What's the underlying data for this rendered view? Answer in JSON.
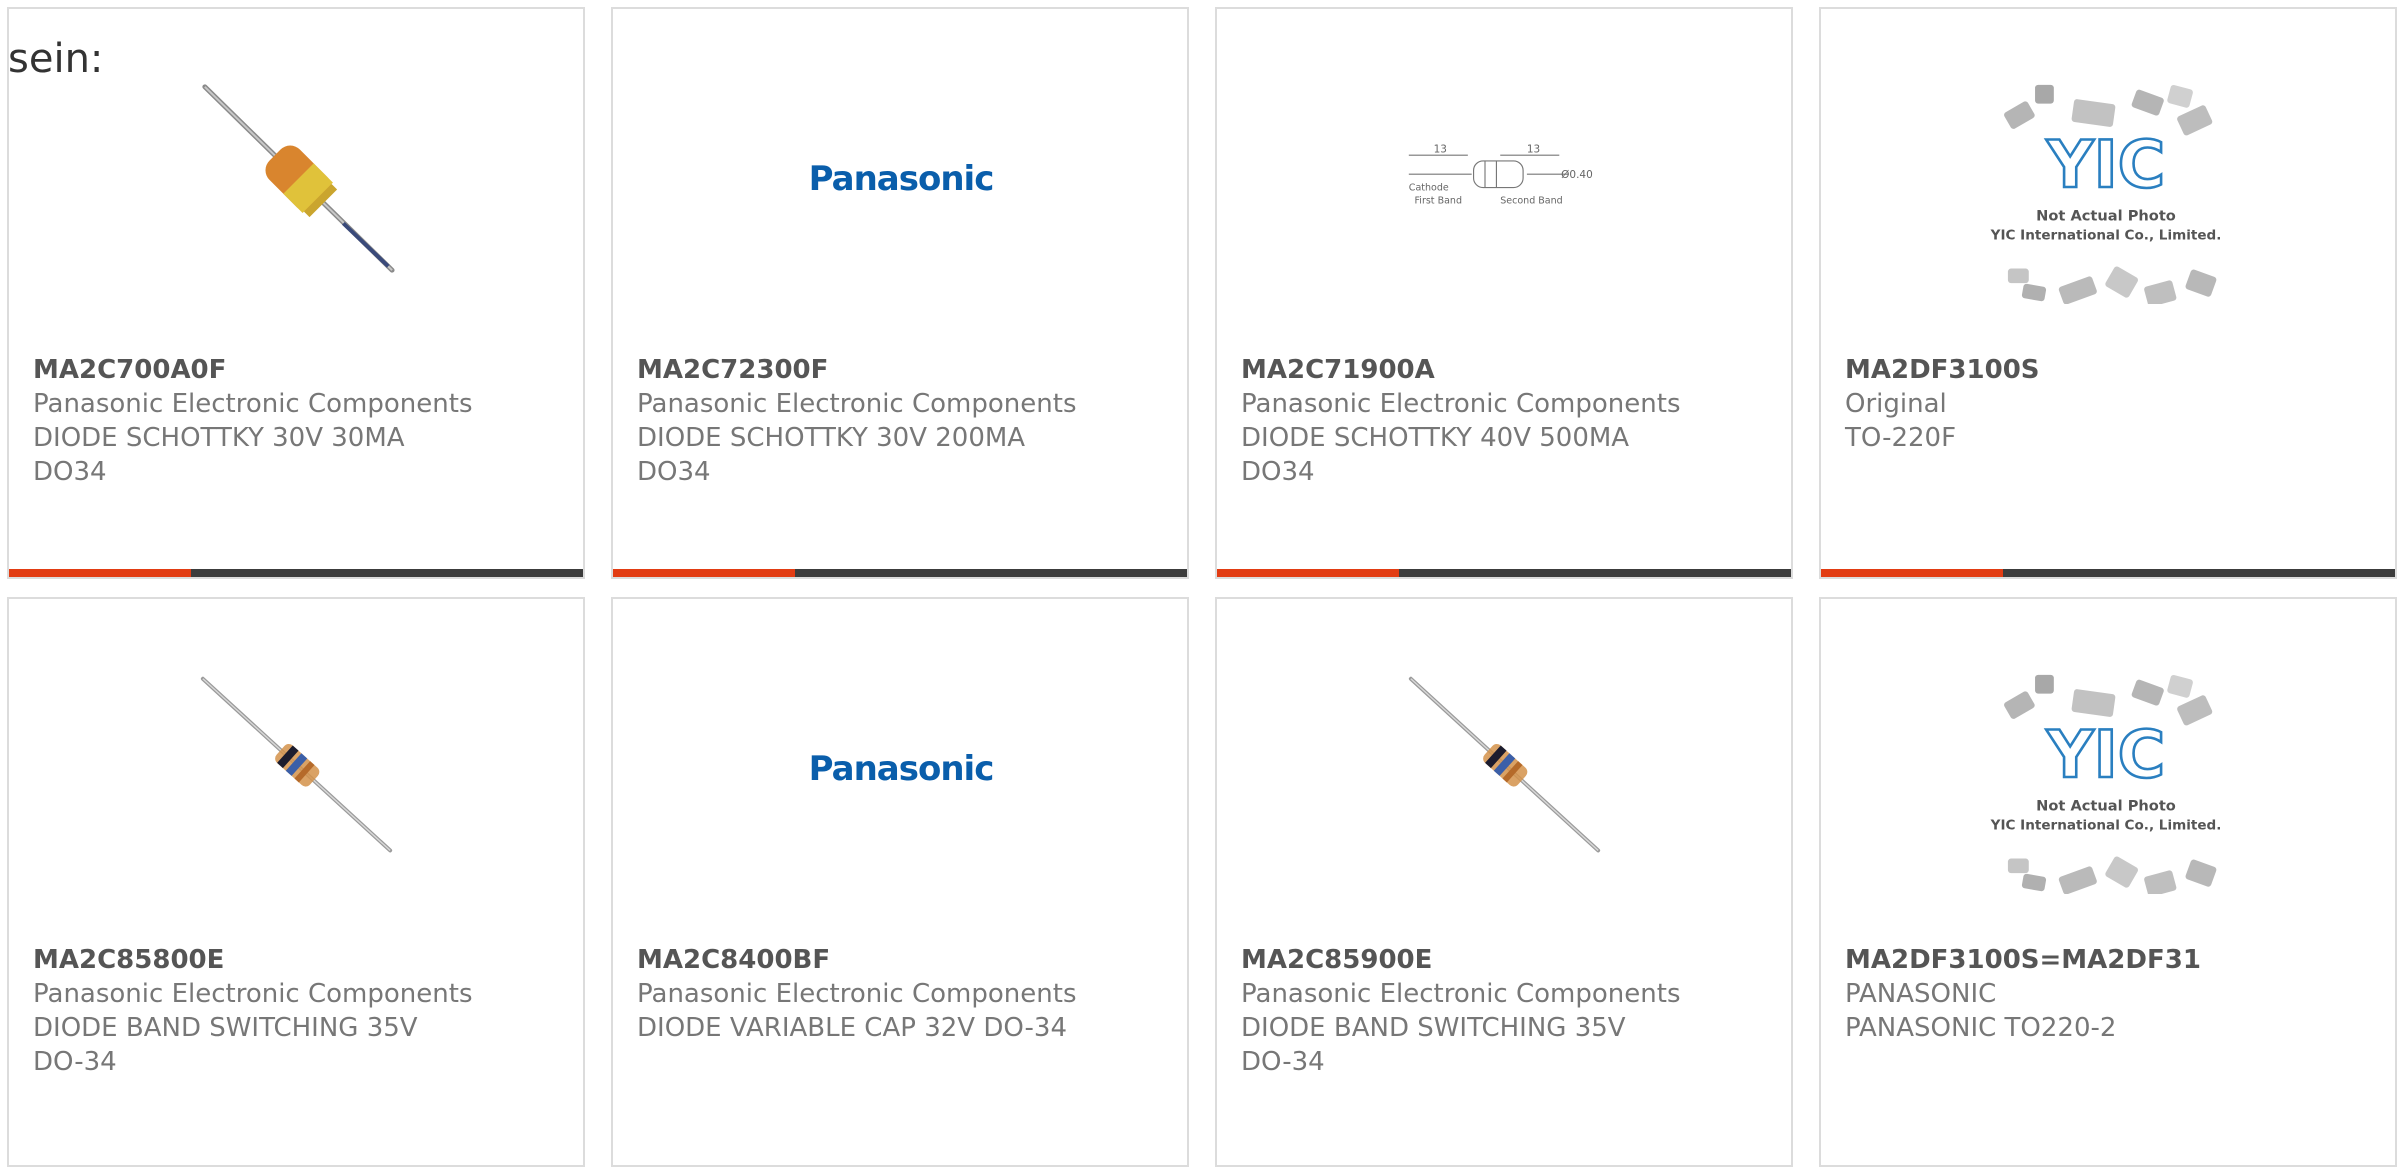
{
  "intro_text": "sein:",
  "colors": {
    "accent": "#e23c13",
    "bar": "#3c3c3c",
    "border": "#dcdcdc",
    "panasonic_blue": "#0a5eab",
    "yic_blue": "#2a7fc0"
  },
  "cards": [
    {
      "part": "MA2C700A0F",
      "lines": [
        "Panasonic Electronic Components",
        "DIODE SCHOTTKY 30V 30MA",
        "DO34"
      ],
      "image": "diode-orange-band"
    },
    {
      "part": "MA2C72300F",
      "lines": [
        "Panasonic Electronic Components",
        "DIODE SCHOTTKY 30V 200MA",
        "DO34"
      ],
      "image": "panasonic-logo",
      "logo_text": "Panasonic"
    },
    {
      "part": "MA2C71900A",
      "lines": [
        "Panasonic Electronic Components",
        "DIODE SCHOTTKY 40V 500MA",
        "DO34"
      ],
      "image": "diode-drawing",
      "drawing": {
        "dim_left": "13",
        "dim_right": "13",
        "diam": "Ø0.40",
        "cathode": "Cathode",
        "first_band": "First Band",
        "second_band": "Second Band"
      }
    },
    {
      "part": "MA2DF3100S",
      "lines": [
        "Original",
        "TO-220F"
      ],
      "image": "yic-placeholder",
      "yic": {
        "logo": "YIC",
        "line1": "Not Actual Photo",
        "line2": "YIC International Co., Limited."
      }
    },
    {
      "part": "MA2C85800E",
      "lines": [
        "Panasonic Electronic Components",
        "DIODE BAND SWITCHING 35V",
        "DO-34"
      ],
      "image": "diode-glass"
    },
    {
      "part": "MA2C8400BF",
      "lines": [
        "Panasonic Electronic Components",
        "DIODE VARIABLE CAP 32V DO-34"
      ],
      "image": "panasonic-logo",
      "logo_text": "Panasonic"
    },
    {
      "part": "MA2C85900E",
      "lines": [
        "Panasonic Electronic Components",
        "DIODE BAND SWITCHING 35V",
        "DO-34"
      ],
      "image": "diode-glass"
    },
    {
      "part": "MA2DF3100S=MA2DF31",
      "lines": [
        "PANASONIC",
        "PANASONIC TO220-2"
      ],
      "image": "yic-placeholder",
      "yic": {
        "logo": "YIC",
        "line1": "Not Actual Photo",
        "line2": "YIC International Co., Limited."
      }
    }
  ]
}
